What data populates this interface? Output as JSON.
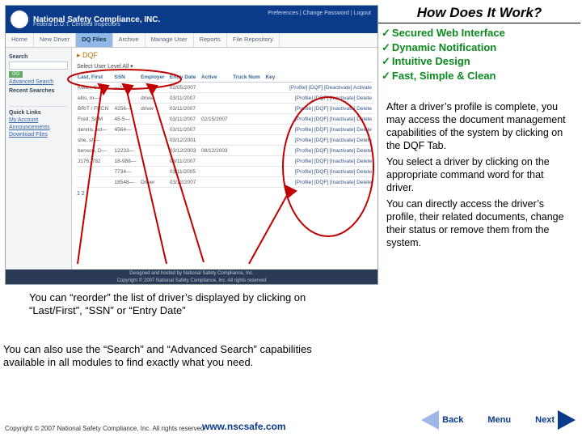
{
  "title": "How Does It Work?",
  "bullets": [
    "Secured Web Interface",
    "Dynamic Notification",
    "Intuitive Design",
    "Fast, Simple & Clean"
  ],
  "body": [
    "After a driver’s profile is complete, you may access the document management capabilities of the system by clicking on the DQF Tab.",
    "You select a driver by clicking on the appropriate command word for that driver.",
    "You can directly access the driver’s profile, their related documents, change their status or remove them from the system."
  ],
  "caption1": "You can “reorder” the list of driver’s displayed by clicking on “Last/First”, “SSN” or “Entry Date”",
  "caption2": "You can also use the “Search” and “Advanced Search” capabilities available in all modules to find exactly what you need.",
  "copyright": "Copyright © 2007 National Safety Compliance, Inc. All rights reserved",
  "url": "www.nscsafe.com",
  "nav": {
    "back": "Back",
    "menu": "Menu",
    "next": "Next"
  },
  "shot": {
    "brand": "National Safety Compliance, INC.",
    "sub": "Federal D.O.T. Certified Inspectors",
    "prefs": "Preferences  |  Change Password  |  Logout",
    "tabs": [
      "Home",
      "New Driver",
      "DQ Files",
      "Archive",
      "Manage User",
      "Reports",
      "File Repository"
    ],
    "side_search": "Search",
    "side_go": "GO",
    "side_adv": "Advanced Search",
    "side_recent": "Recent Searches",
    "side_links_h": "Quick Links",
    "side_links": [
      "My Account",
      "Announcements",
      "Download Files"
    ],
    "crumb": "DQF",
    "select": "Select User Level  All ▾",
    "cols": [
      "Last, First",
      "SSN",
      "Employer",
      "Entry Date",
      "Active",
      "Truck Num",
      "Key"
    ],
    "rows": [
      {
        "c": [
          "Keller, S—",
          "—1502",
          "",
          "02/05/2007",
          "",
          ""
        ],
        "a": [
          "[Profile]",
          "[DQF]",
          "[Deactivate]",
          "Activate"
        ]
      },
      {
        "c": [
          "ellis, m—",
          "",
          "driver",
          "03/11/2007",
          "",
          ""
        ],
        "a": [
          "[Profile]",
          "[DQF]",
          "[Inactivate]",
          "Delete"
        ]
      },
      {
        "c": [
          "BRIT / FRCN",
          "4256—",
          "driver",
          "03/11/2007",
          "",
          ""
        ],
        "a": [
          "[Profile]",
          "[DQF]",
          "[Inactivate]",
          "Delete"
        ]
      },
      {
        "c": [
          "Fred, SAM",
          "45-5—",
          "",
          "03/11/2007",
          "02/15/2007",
          ""
        ],
        "a": [
          "[Profile]",
          "[DQF]",
          "[Inactivate]",
          "Delete"
        ]
      },
      {
        "c": [
          "dennis, ed—",
          "4564—",
          "",
          "03/11/2007",
          "",
          ""
        ],
        "a": "[Profile] [DQF] [Inactivate] Delete"
      },
      {
        "c": [
          "she, sh—",
          "",
          "",
          "03/12/2001",
          "",
          ""
        ],
        "a": [
          "[Profile]",
          "[DQF]",
          "[Inactivate]",
          "Delete"
        ]
      },
      {
        "c": [
          "benson, D—",
          "12233—",
          "",
          "03/12/2003",
          "08/12/2003",
          ""
        ],
        "a": [
          "[Profile]",
          "[DQF]",
          "[Inactivate]",
          "Delete"
        ]
      },
      {
        "c": [
          "J176, 782",
          "18-988—",
          "",
          "03/11/2007",
          "",
          ""
        ],
        "a": [
          "[Profile]",
          "[DQF]",
          "[Inactivate]",
          "Delete"
        ]
      },
      {
        "c": [
          "",
          "7734—",
          "",
          "03/11/2005",
          "",
          ""
        ],
        "a": [
          "[Profile]",
          "[DQF]",
          "[Inactivate]",
          "Delete"
        ]
      },
      {
        "c": [
          "",
          "18548—",
          "Driver",
          "03/12/2007",
          "",
          ""
        ],
        "a": [
          "[Profile]",
          "[DQF]",
          "[Inactivate]",
          "Delete"
        ]
      }
    ],
    "pager": "1 2",
    "foot1": "Designed and hosted by National Safety Compliance, Inc.",
    "foot2": "Copyright © 2007 National Safety Compliance, Inc. All rights reserved"
  }
}
